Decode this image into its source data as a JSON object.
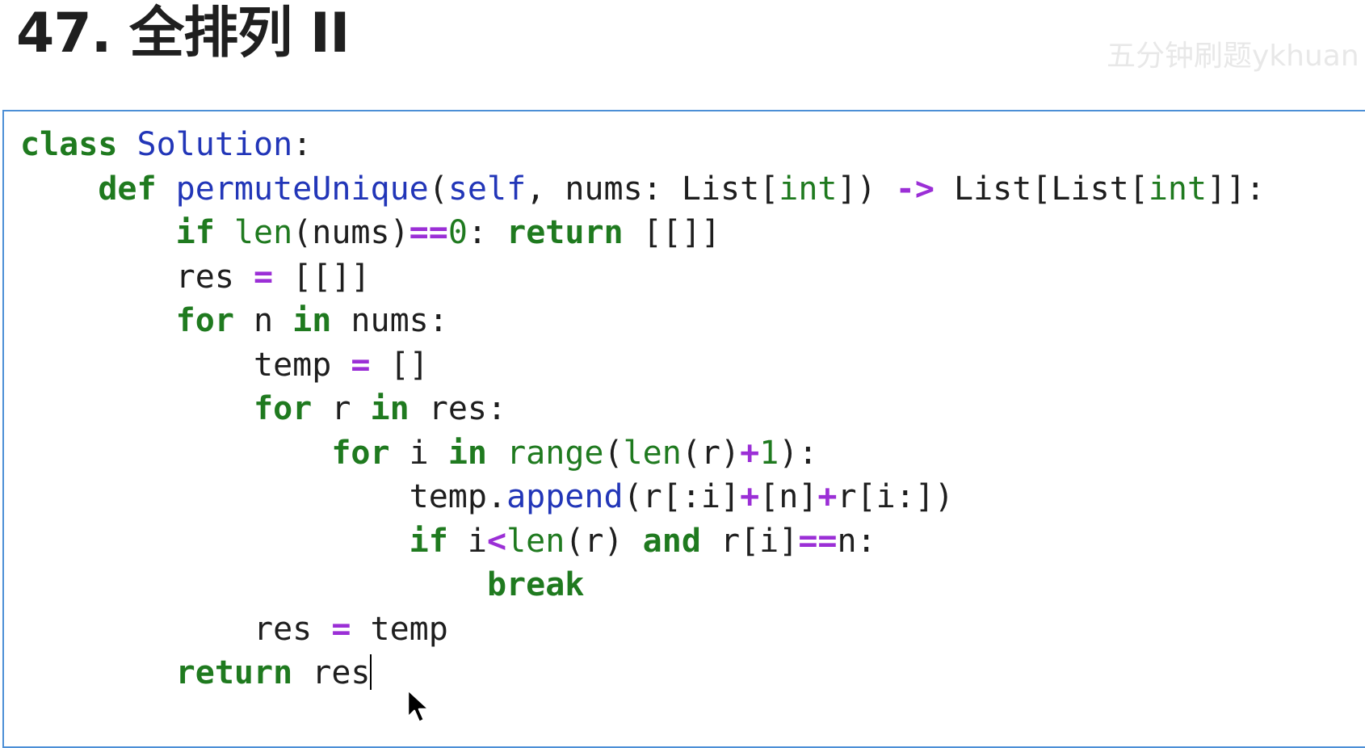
{
  "page": {
    "title": "47. 全排列 II",
    "watermark": "五分钟刷题ykhuan"
  },
  "editor": {
    "lines": [
      [
        {
          "t": "class",
          "k": "kw"
        },
        {
          "t": " ",
          "k": "txt"
        },
        {
          "t": "Solution",
          "k": "fn"
        },
        {
          "t": ":",
          "k": "txt"
        }
      ],
      [
        {
          "t": "    ",
          "k": "txt"
        },
        {
          "t": "def",
          "k": "kw"
        },
        {
          "t": " ",
          "k": "txt"
        },
        {
          "t": "permuteUnique",
          "k": "fn"
        },
        {
          "t": "(",
          "k": "txt"
        },
        {
          "t": "self",
          "k": "fn"
        },
        {
          "t": ", nums: List[",
          "k": "txt"
        },
        {
          "t": "int",
          "k": "bi"
        },
        {
          "t": "]) ",
          "k": "txt"
        },
        {
          "t": "->",
          "k": "op"
        },
        {
          "t": " List[List[",
          "k": "txt"
        },
        {
          "t": "int",
          "k": "bi"
        },
        {
          "t": "]]:",
          "k": "txt"
        }
      ],
      [
        {
          "t": "        ",
          "k": "txt"
        },
        {
          "t": "if",
          "k": "kw"
        },
        {
          "t": " ",
          "k": "txt"
        },
        {
          "t": "len",
          "k": "bi"
        },
        {
          "t": "(nums)",
          "k": "txt"
        },
        {
          "t": "==",
          "k": "op"
        },
        {
          "t": "0",
          "k": "num"
        },
        {
          "t": ": ",
          "k": "txt"
        },
        {
          "t": "return",
          "k": "kw"
        },
        {
          "t": " [[]]",
          "k": "txt"
        }
      ],
      [
        {
          "t": "        res ",
          "k": "txt"
        },
        {
          "t": "=",
          "k": "op"
        },
        {
          "t": " [[]]",
          "k": "txt"
        }
      ],
      [
        {
          "t": "        ",
          "k": "txt"
        },
        {
          "t": "for",
          "k": "kw"
        },
        {
          "t": " n ",
          "k": "txt"
        },
        {
          "t": "in",
          "k": "kw"
        },
        {
          "t": " nums:",
          "k": "txt"
        }
      ],
      [
        {
          "t": "            temp ",
          "k": "txt"
        },
        {
          "t": "=",
          "k": "op"
        },
        {
          "t": " []",
          "k": "txt"
        }
      ],
      [
        {
          "t": "            ",
          "k": "txt"
        },
        {
          "t": "for",
          "k": "kw"
        },
        {
          "t": " r ",
          "k": "txt"
        },
        {
          "t": "in",
          "k": "kw"
        },
        {
          "t": " res:",
          "k": "txt"
        }
      ],
      [
        {
          "t": "                ",
          "k": "txt"
        },
        {
          "t": "for",
          "k": "kw"
        },
        {
          "t": " i ",
          "k": "txt"
        },
        {
          "t": "in",
          "k": "kw"
        },
        {
          "t": " ",
          "k": "txt"
        },
        {
          "t": "range",
          "k": "bi"
        },
        {
          "t": "(",
          "k": "txt"
        },
        {
          "t": "len",
          "k": "bi"
        },
        {
          "t": "(r)",
          "k": "txt"
        },
        {
          "t": "+",
          "k": "op"
        },
        {
          "t": "1",
          "k": "num"
        },
        {
          "t": "):",
          "k": "txt"
        }
      ],
      [
        {
          "t": "                    temp.",
          "k": "txt"
        },
        {
          "t": "append",
          "k": "fn"
        },
        {
          "t": "(r[:i]",
          "k": "txt"
        },
        {
          "t": "+",
          "k": "op"
        },
        {
          "t": "[n]",
          "k": "txt"
        },
        {
          "t": "+",
          "k": "op"
        },
        {
          "t": "r[i:])",
          "k": "txt"
        }
      ],
      [
        {
          "t": "                    ",
          "k": "txt"
        },
        {
          "t": "if",
          "k": "kw"
        },
        {
          "t": " i",
          "k": "txt"
        },
        {
          "t": "<",
          "k": "op"
        },
        {
          "t": "len",
          "k": "bi"
        },
        {
          "t": "(r) ",
          "k": "txt"
        },
        {
          "t": "and",
          "k": "kw"
        },
        {
          "t": " r[i]",
          "k": "txt"
        },
        {
          "t": "==",
          "k": "op"
        },
        {
          "t": "n:",
          "k": "txt"
        }
      ],
      [
        {
          "t": "                        ",
          "k": "txt"
        },
        {
          "t": "break",
          "k": "kw"
        }
      ],
      [
        {
          "t": "            res ",
          "k": "txt"
        },
        {
          "t": "=",
          "k": "op"
        },
        {
          "t": " temp",
          "k": "txt"
        }
      ],
      [
        {
          "t": "        ",
          "k": "txt"
        },
        {
          "t": "return",
          "k": "kw"
        },
        {
          "t": " res",
          "k": "txt"
        }
      ]
    ],
    "caret_line": 12
  },
  "colors": {
    "keyword": "#1f7a1f",
    "function": "#2236b8",
    "operator": "#9b2fd6",
    "text": "#1e1e1e",
    "border": "#4c8fd6"
  },
  "icons": {
    "cursor": "mouse-pointer-arrow-icon"
  }
}
